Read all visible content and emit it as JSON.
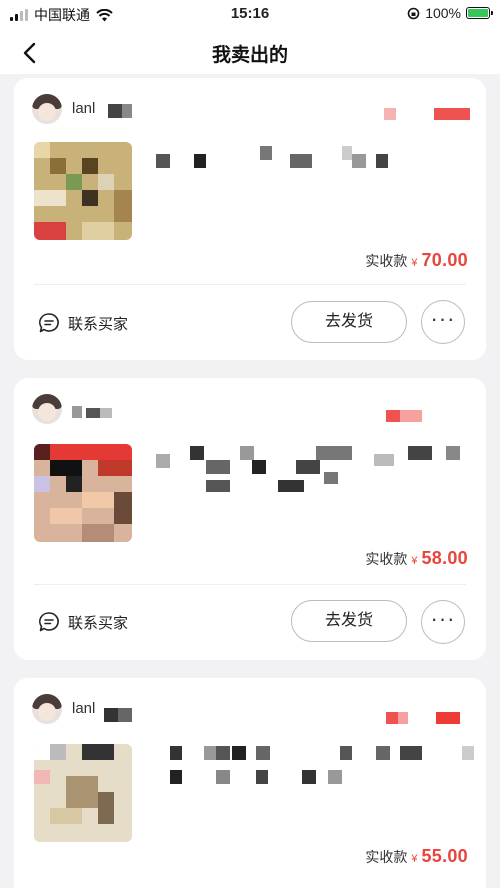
{
  "status_bar": {
    "carrier": "中国联通",
    "time": "15:16",
    "battery": "100%"
  },
  "nav": {
    "title": "我卖出的"
  },
  "orders": [
    {
      "username": "lanl",
      "price_label": "实收款",
      "currency": "¥",
      "price": "70.00",
      "contact_label": "联系买家",
      "ship_label": "去发货",
      "more_label": "···"
    },
    {
      "username": "",
      "price_label": "实收款",
      "currency": "¥",
      "price": "58.00",
      "contact_label": "联系买家",
      "ship_label": "去发货",
      "more_label": "···"
    },
    {
      "username": "lanl",
      "price_label": "实收款",
      "currency": "¥",
      "price": "55.00"
    }
  ],
  "colors": {
    "accent": "#e8453c",
    "battery": "#34c759"
  },
  "icons": [
    "signal-icon",
    "wifi-icon",
    "orientation-lock-icon",
    "battery-icon",
    "back-arrow-icon",
    "chat-icon",
    "more-icon"
  ]
}
